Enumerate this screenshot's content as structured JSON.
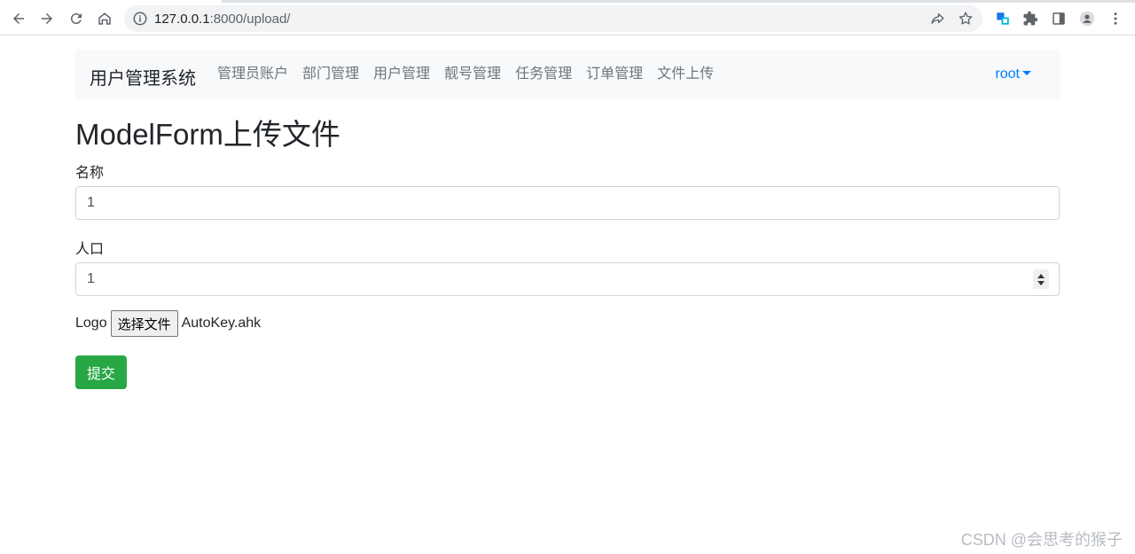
{
  "browser": {
    "url_host": "127.0.0.1",
    "url_path": ":8000/upload/"
  },
  "navbar": {
    "brand": "用户管理系统",
    "links": [
      "管理员账户",
      "部门管理",
      "用户管理",
      "靓号管理",
      "任务管理",
      "订单管理",
      "文件上传"
    ],
    "user": "root"
  },
  "form": {
    "title": "ModelForm上传文件",
    "name_label": "名称",
    "name_value": "1",
    "population_label": "人口",
    "population_value": "1",
    "logo_label": "Logo",
    "file_button": "选择文件",
    "file_name": "AutoKey.ahk",
    "submit_label": "提交"
  },
  "watermark": "CSDN @会思考的猴子",
  "colors": {
    "brand_blue": "#007bff",
    "success_green": "#28a745",
    "navbar_bg": "#f8f9fa"
  }
}
